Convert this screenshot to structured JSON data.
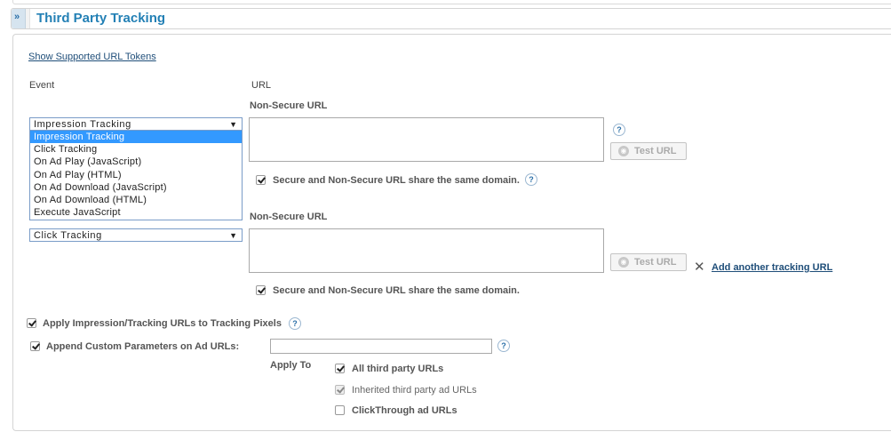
{
  "section": {
    "title": "Third Party Tracking",
    "toggle_icon": "double-chevron-down-icon"
  },
  "tokens_link": "Show Supported URL Tokens",
  "columns": {
    "event": "Event",
    "url": "URL"
  },
  "dropdown": {
    "options": [
      "Impression Tracking",
      "Click Tracking",
      "On Ad Play (JavaScript)",
      "On Ad Play (HTML)",
      "On Ad Download (JavaScript)",
      "On Ad Download (HTML)",
      "Execute JavaScript"
    ],
    "highlighted": "Impression Tracking"
  },
  "rows": [
    {
      "event": "Impression Tracking",
      "url_label": "Non-Secure URL",
      "url_value": "",
      "test_button": "Test URL",
      "same_domain_label": "Secure and Non-Secure URL share the same domain.",
      "same_domain_checked": true
    },
    {
      "event": "Click Tracking",
      "url_label": "Non-Secure URL",
      "url_value": "",
      "test_button": "Test URL",
      "same_domain_label": "Secure and Non-Secure URL share the same domain.",
      "same_domain_checked": true
    }
  ],
  "add_tracking_link": "Add another tracking URL",
  "apply_pixels_label": "Apply Impression/Tracking URLs to Tracking Pixels",
  "append_params_label": "Append Custom Parameters on Ad URLs:",
  "append_params_value": "",
  "apply_to_label": "Apply To",
  "apply_to_options": [
    {
      "label": "All third party URLs",
      "checked": true,
      "disabled": false
    },
    {
      "label": "Inherited third party ad URLs",
      "checked": true,
      "disabled": true
    },
    {
      "label": "ClickThrough ad URLs",
      "checked": false,
      "disabled": false
    }
  ],
  "help_glyph": "?"
}
